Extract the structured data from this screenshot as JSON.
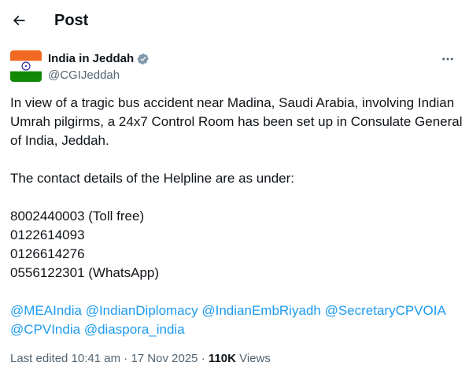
{
  "header": {
    "title": "Post"
  },
  "author": {
    "name": "India in Jeddah",
    "handle": "@CGIJeddah",
    "verified": true
  },
  "post": {
    "paragraph1": "In view of a tragic bus accident near Madina, Saudi Arabia, involving Indian Umrah pilgirms, a 24x7 Control Room has been set up in Consulate General of India, Jeddah.",
    "paragraph2": "The contact details of the Helpline are as under:",
    "phones": [
      "8002440003 (Toll free)",
      "0122614093",
      "0126614276",
      "0556122301 (WhatsApp)"
    ],
    "mentions": [
      "@MEAIndia",
      "@IndianDiplomacy",
      "@IndianEmbRiyadh",
      "@SecretaryCPVOIA",
      "@CPVIndia",
      "@diaspora_india"
    ]
  },
  "meta": {
    "edited": "Last edited 10:41 am",
    "separator": "·",
    "date": "17 Nov 2025",
    "views_count": "110K",
    "views_label": "Views"
  },
  "colors": {
    "link": "#1d9bf0",
    "verified": "#829aab",
    "text": "#0f1419",
    "muted": "#536471"
  }
}
